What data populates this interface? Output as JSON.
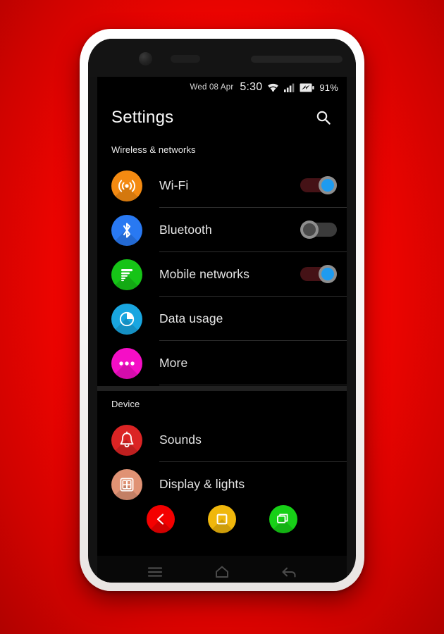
{
  "status_bar": {
    "date": "Wed 08 Apr",
    "time": "5:30",
    "battery_percent": "91%",
    "icons": [
      "wifi-icon",
      "cellular-signal-icon",
      "battery-charging-icon"
    ]
  },
  "action_bar": {
    "title": "Settings",
    "search_icon": "search-icon"
  },
  "sections": [
    {
      "header": "Wireless & networks",
      "rows": [
        {
          "label": "Wi-Fi",
          "icon": "wifi-broadcast-icon",
          "icon_color": "#f48a11",
          "control": "toggle",
          "state": "on"
        },
        {
          "label": "Bluetooth",
          "icon": "bluetooth-icon",
          "icon_color": "#2979f2",
          "control": "toggle",
          "state": "off"
        },
        {
          "label": "Mobile networks",
          "icon": "signal-bars-icon",
          "icon_color": "#16c417",
          "control": "toggle",
          "state": "on"
        },
        {
          "label": "Data usage",
          "icon": "pie-chart-icon",
          "icon_color": "#19a6e0",
          "control": "none",
          "state": ""
        },
        {
          "label": "More",
          "icon": "more-dots-icon",
          "icon_color": "#f50ec6",
          "control": "none",
          "state": ""
        }
      ]
    },
    {
      "header": "Device",
      "rows": [
        {
          "label": "Sounds",
          "icon": "bell-icon",
          "icon_color": "#db2424",
          "control": "none",
          "state": ""
        },
        {
          "label": "Display & lights",
          "icon": "seven-segment-icon",
          "icon_color": "#e09274",
          "control": "none",
          "state": ""
        }
      ]
    }
  ],
  "floating_nav": [
    {
      "name": "back",
      "icon": "chevron-left-icon",
      "color": "#f40000"
    },
    {
      "name": "home",
      "icon": "square-outline-icon",
      "color": "#f0b70c"
    },
    {
      "name": "recents",
      "icon": "stacked-windows-icon",
      "color": "#17d017"
    }
  ],
  "nav_bar": [
    {
      "name": "menu",
      "icon": "hamburger-menu-icon"
    },
    {
      "name": "home",
      "icon": "home-outline-icon"
    },
    {
      "name": "back",
      "icon": "back-arrow-icon"
    }
  ],
  "colors": {
    "wallpaper": "#f60400",
    "screen_bg": "#000000",
    "toggle_on_track": "#451216",
    "toggle_on_thumb": "#1e9bf0",
    "toggle_off_track": "#3b3b3b",
    "divider": "#2e2e2e"
  }
}
